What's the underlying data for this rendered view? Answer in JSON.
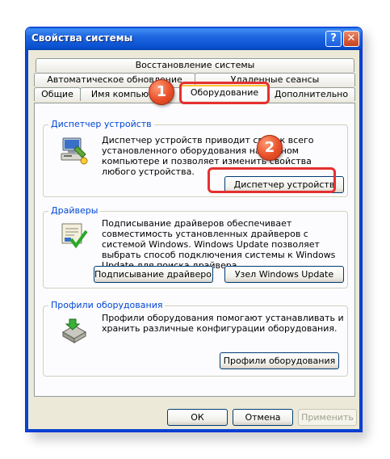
{
  "window": {
    "title": "Свойства системы",
    "help_label": "?",
    "close_label": "✕"
  },
  "tabs": {
    "row1": [
      {
        "label": "Восстановление системы"
      }
    ],
    "row2": [
      {
        "label": "Автоматическое обновление"
      },
      {
        "label": "Удаленные сеансы"
      }
    ],
    "row3": [
      {
        "label": "Общие"
      },
      {
        "label": "Имя компьютера"
      },
      {
        "label": "Оборудование",
        "active": true
      },
      {
        "label": "Дополнительно"
      }
    ]
  },
  "groups": {
    "device_manager": {
      "title": "Диспетчер устройств",
      "text": "Диспетчер устройств приводит список всего установленного оборудования на данном компьютере и позволяет изменить свойства любого устройства.",
      "button": "Диспетчер устройств",
      "icon": "device-manager-icon"
    },
    "drivers": {
      "title": "Драйверы",
      "text": "Подписывание драйверов обеспечивает совместимость установленных драйверов с системой Windows. Windows Update позволяет выбрать способ подключения системы к Windows Update для поиска драйвера.",
      "button_signing": "Подписывание драйверов",
      "button_update": "Узел Windows Update",
      "icon": "driver-signing-icon"
    },
    "profiles": {
      "title": "Профили оборудования",
      "text": "Профили оборудования помогают устанавливать и хранить различные конфигурации оборудования.",
      "button": "Профили оборудования",
      "icon": "hardware-profiles-icon"
    }
  },
  "footer": {
    "ok": "ОК",
    "cancel": "Отмена",
    "apply": "Применить"
  },
  "annotations": {
    "badge1": "1",
    "badge2": "2",
    "highlight_color": "#e53030"
  }
}
